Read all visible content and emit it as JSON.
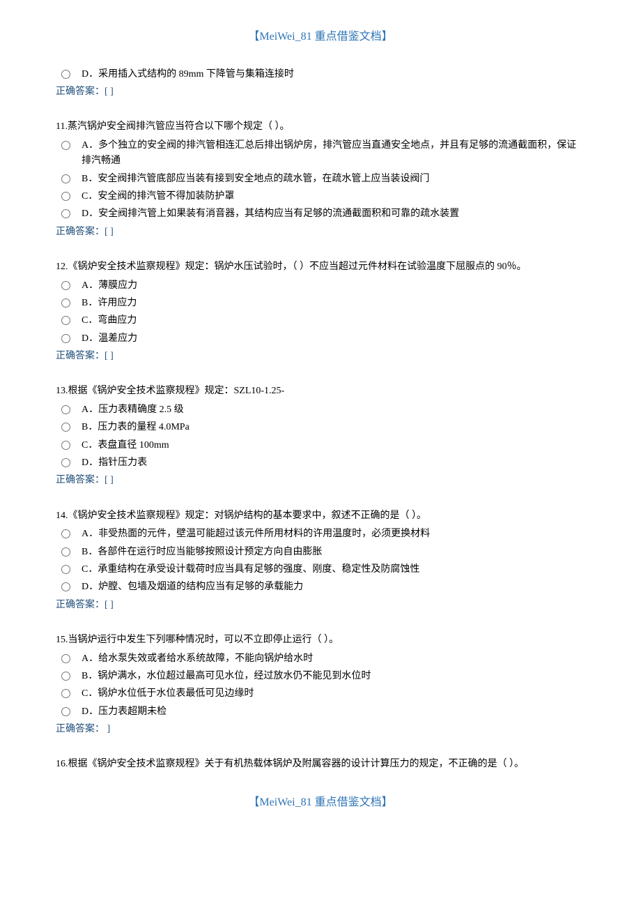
{
  "header": "【MeiWei_81 重点借鉴文档】",
  "footer": "【MeiWei_81 重点借鉴文档】",
  "answer_label": "正确答案：",
  "answer_blank": "[   ]",
  "leading_option": {
    "text": "D．采用插入式结构的 89mm 下降管与集箱连接时"
  },
  "questions": [
    {
      "num": "11",
      "stem": "蒸汽锅炉安全阀排汽管应当符合以下哪个规定（   ）。",
      "options": [
        "A．多个独立的安全阀的排汽管相连汇总后排出锅炉房，排汽管应当直通安全地点，并且有足够的流通截面积，保证排汽畅通",
        "B．安全阀排汽管底部应当装有接到安全地点的疏水管，在疏水管上应当装设阀门",
        "C．安全阀的排汽管不得加装防护罩",
        "D．安全阀排汽管上如果装有消音器，其结构应当有足够的流通截面积和可靠的疏水装置"
      ]
    },
    {
      "num": "12",
      "stem": "《锅炉安全技术监察规程》规定：锅炉水压试验时，（   ）不应当超过元件材料在试验温度下屈服点的 90％。",
      "options": [
        "A．薄膜应力",
        "B．许用应力",
        "C．弯曲应力",
        "D．温差应力"
      ]
    },
    {
      "num": "13",
      "stem": "根据《锅炉安全技术监察规程》规定：SZL10-1.25-",
      "options": [
        "A．压力表精确度 2.5 级",
        "B．压力表的量程 4.0MPa",
        "C．表盘直径 100mm",
        "D．指针压力表"
      ]
    },
    {
      "num": "14",
      "stem": "《锅炉安全技术监察规程》规定：对锅炉结构的基本要求中，叙述不正确的是（   ）。",
      "options": [
        "A．非受热面的元件，壁温可能超过该元件所用材料的许用温度时，必须更换材料",
        "B．各部件在运行时应当能够按照设计预定方向自由膨胀",
        "C．承重结构在承受设计载荷时应当具有足够的强度、刚度、稳定性及防腐蚀性",
        "D．炉膛、包墙及烟道的结构应当有足够的承载能力"
      ]
    },
    {
      "num": "15",
      "stem": "当锅炉运行中发生下列哪种情况时，可以不立即停止运行（   ）。",
      "options": [
        "A．给水泵失效或者给水系统故障，不能向锅炉给水时",
        "B．锅炉满水，水位超过最高可见水位，经过放水仍不能见到水位时",
        "C．锅炉水位低于水位表最低可见边缘时",
        "D．压力表超期未检"
      ],
      "answer_spaced": true
    },
    {
      "num": "16",
      "stem": "根据《锅炉安全技术监察规程》关于有机热载体锅炉及附属容器的设计计算压力的规定，不正确的是（   ）。",
      "no_options": true
    }
  ]
}
